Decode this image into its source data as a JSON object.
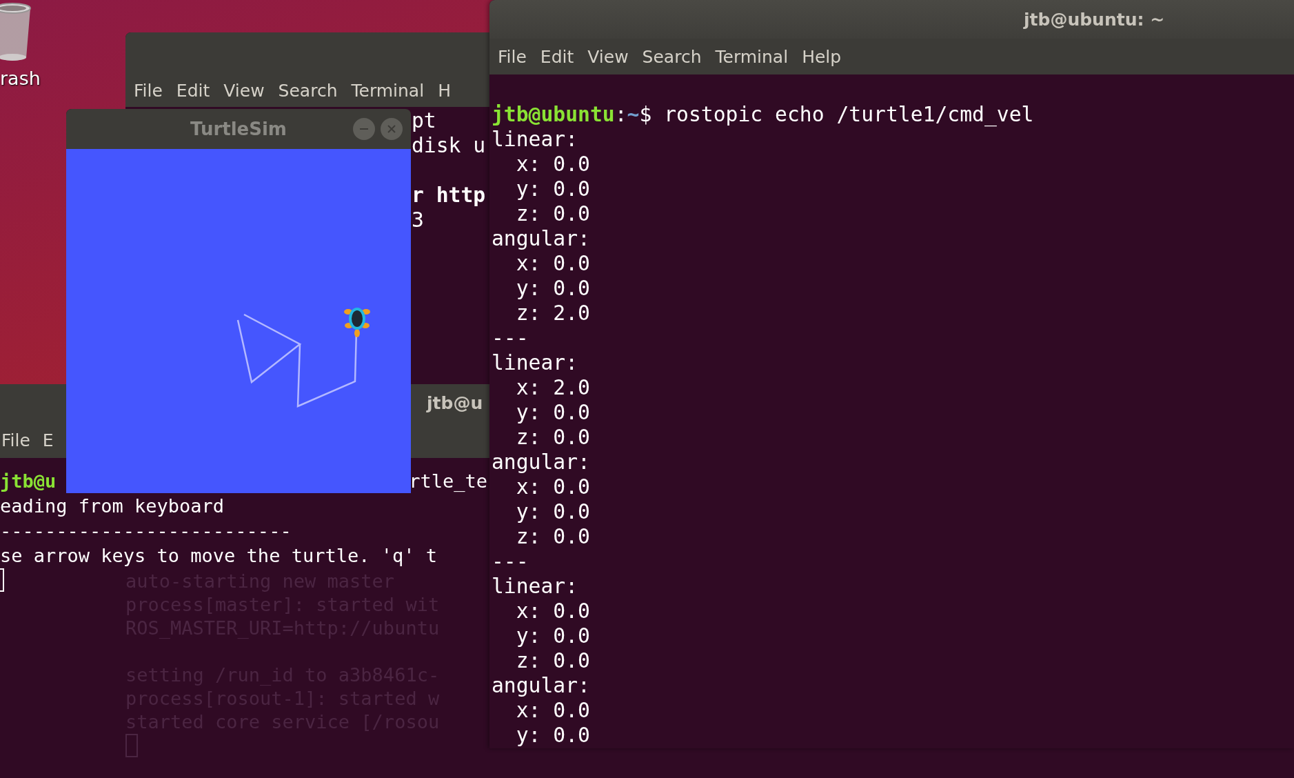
{
  "trash": {
    "label": "rash"
  },
  "back_terminal": {
    "menu": [
      "File",
      "Edit",
      "View",
      "Search",
      "Terminal",
      "H"
    ],
    "lines": [
      {
        "kind": "text",
        "text": "pt",
        "bold": false
      },
      {
        "kind": "text",
        "text": "disk u",
        "bold": false
      },
      {
        "kind": "blank"
      },
      {
        "kind": "text",
        "text": "r http",
        "bold": true
      },
      {
        "kind": "text",
        "text": "3",
        "bold": false
      }
    ]
  },
  "lower_terminal": {
    "title": "jtb@u",
    "menu": [
      "File",
      "E"
    ],
    "prompt_user": "jtb@u",
    "command_tail": "rtle_te",
    "lines": [
      "eading from keyboard",
      "--------------------------",
      "se arrow keys to move the turtle. 'q' t"
    ],
    "ghost_lines": [
      {
        "kind": "text",
        "text": "auto-starting new master"
      },
      {
        "kind": "text",
        "text": "process[master]: started wit"
      },
      {
        "kind": "text",
        "text": "ROS_MASTER_URI=http://ubuntu"
      },
      {
        "kind": "blank"
      },
      {
        "kind": "text",
        "text": "setting /run_id to a3b8461c-"
      },
      {
        "kind": "text",
        "text": "process[rosout-1]: started w"
      },
      {
        "kind": "text",
        "text": "started core service [/rosou"
      }
    ]
  },
  "turtlesim": {
    "title": "TurtleSim"
  },
  "echo_terminal": {
    "title": "jtb@ubuntu: ~",
    "menu": [
      "File",
      "Edit",
      "View",
      "Search",
      "Terminal",
      "Help"
    ],
    "prompt": {
      "user": "jtb@ubuntu",
      "sep": ":",
      "path": "~",
      "command": "$ rostopic echo /turtle1/cmd_vel"
    },
    "lines": [
      "linear:",
      "  x: 0.0",
      "  y: 0.0",
      "  z: 0.0",
      "angular:",
      "  x: 0.0",
      "  y: 0.0",
      "  z: 2.0",
      "---",
      "linear:",
      "  x: 2.0",
      "  y: 0.0",
      "  z: 0.0",
      "angular:",
      "  x: 0.0",
      "  y: 0.0",
      "  z: 0.0",
      "---",
      "linear:",
      "  x: 0.0",
      "  y: 0.0",
      "  z: 0.0",
      "angular:",
      "  x: 0.0",
      "  y: 0.0"
    ]
  }
}
